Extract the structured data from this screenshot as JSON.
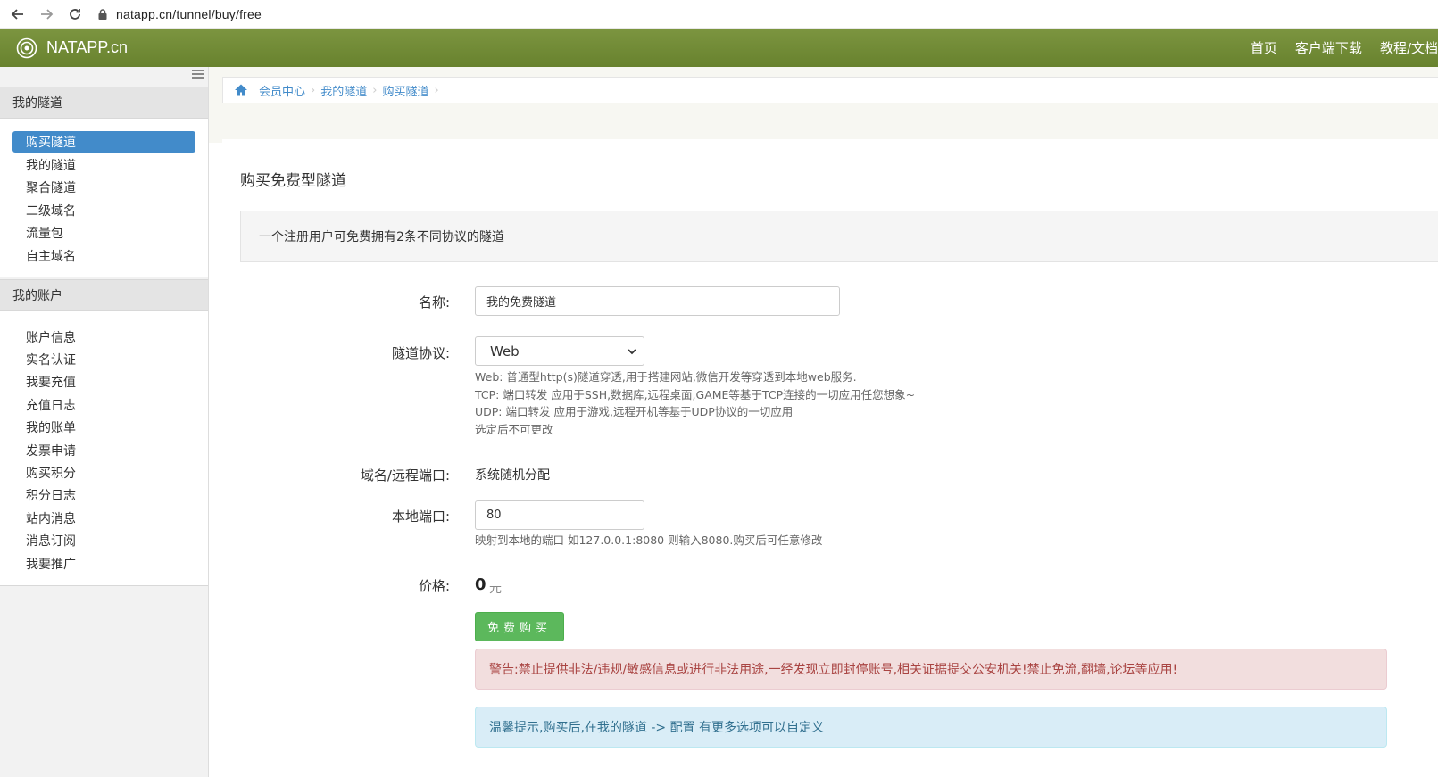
{
  "browser": {
    "url": "natapp.cn/tunnel/buy/free"
  },
  "nav": {
    "brand": "NATAPP.cn",
    "links": [
      "首页",
      "客户端下载",
      "教程/文档"
    ]
  },
  "sidebar": {
    "sections": [
      {
        "title": "我的隧道",
        "items": [
          "购买隧道",
          "我的隧道",
          "聚合隧道",
          "二级域名",
          "流量包",
          "自主域名"
        ],
        "active": 0
      },
      {
        "title": "我的账户",
        "items": [
          "账户信息",
          "实名认证",
          "我要充值",
          "充值日志",
          "我的账单",
          "发票申请",
          "购买积分",
          "积分日志",
          "站内消息",
          "消息订阅",
          "我要推广"
        ]
      }
    ]
  },
  "breadcrumb": [
    "会员中心",
    "我的隧道",
    "购买隧道"
  ],
  "page": {
    "title": "购买免费型隧道",
    "intro": "一个注册用户可免费拥有2条不同协议的隧道"
  },
  "form": {
    "name_label": "名称:",
    "name_value": "我的免费隧道",
    "protocol_label": "隧道协议:",
    "protocol_value": "Web",
    "protocol_help": [
      "Web: 普通型http(s)隧道穿透,用于搭建网站,微信开发等穿透到本地web服务.",
      "TCP: 端口转发 应用于SSH,数据库,远程桌面,GAME等基于TCP连接的一切应用任您想象~",
      "UDP: 端口转发 应用于游戏,远程开机等基于UDP协议的一切应用",
      "选定后不可更改"
    ],
    "domain_label": "域名/远程端口:",
    "domain_value": "系统随机分配",
    "port_label": "本地端口:",
    "port_value": "80",
    "port_help": "映射到本地的端口 如127.0.0.1:8080 则输入8080.购买后可任意修改",
    "price_label": "价格:",
    "price_value": "0",
    "price_unit": "元",
    "buy_label": "免费购买"
  },
  "alerts": {
    "warning": "警告:禁止提供非法/违规/敏感信息或进行非法用途,一经发现立即封停账号,相关证据提交公安机关!禁止免流,翻墙,论坛等应用!",
    "tip": "温馨提示,购买后,在我的隧道 -> 配置 有更多选项可以自定义"
  },
  "colors": {
    "nav_green": "#728c37",
    "active_blue": "#428bca",
    "buy_green": "#5cb85c",
    "danger_bg": "#f2dede",
    "info_bg": "#d9edf7"
  }
}
